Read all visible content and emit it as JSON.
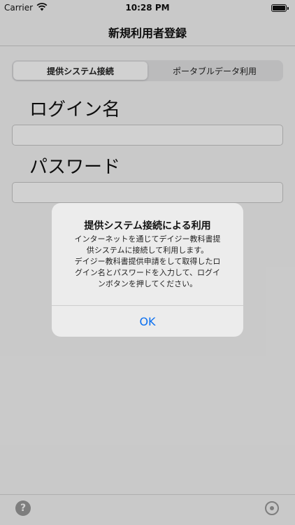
{
  "status_bar": {
    "carrier": "Carrier",
    "time": "10:28 PM",
    "icons": [
      "wifi-icon",
      "battery-icon"
    ]
  },
  "nav": {
    "title": "新規利用者登録"
  },
  "segmented_control": {
    "segments": [
      {
        "label": "提供システム接続",
        "selected": true
      },
      {
        "label": "ポータブルデータ利用",
        "selected": false
      }
    ]
  },
  "form": {
    "login_label": "ログイン名",
    "login_value": "",
    "password_label": "パスワード",
    "password_value": ""
  },
  "bottom_bar": {
    "left_icon": "help-icon",
    "help_glyph": "?",
    "right_icon": "settings-icon"
  },
  "alert": {
    "title": "提供システム接続による利用",
    "message_lines": [
      "インターネットを通じてデイジー教科書提",
      "供システムに接続して利用します。",
      "デイジー教科書提供申請をして取得したロ",
      "グイン名とパスワードを入力して、ログイ",
      "ンボタンを押してください。"
    ],
    "ok_label": "OK"
  },
  "colors": {
    "accent": "#0a6ff0",
    "overlay": "rgba(0,0,0,0.18)",
    "alert_bg": "#ececec"
  }
}
